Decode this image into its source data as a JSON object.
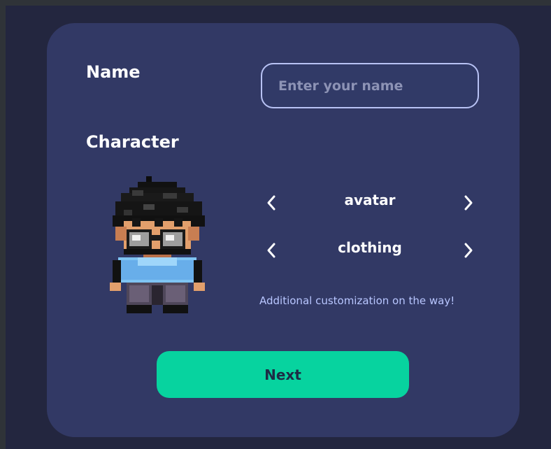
{
  "form": {
    "name_label": "Name",
    "name_placeholder": "Enter your name",
    "name_value": "",
    "character_label": "Character",
    "avatar_option": "avatar",
    "clothing_option": "clothing",
    "note": "Additional customization on the way!",
    "next_label": "Next"
  },
  "icons": {
    "prev": "chevron-left-icon",
    "next": "chevron-right-icon",
    "character": "pixel-character-sprite"
  },
  "colors": {
    "background": "#23263f",
    "card": "#323965",
    "input_border": "#b8c2f4",
    "accent": "#07d39f",
    "note_text": "#b8c6ff",
    "button_text": "#1d2c45"
  }
}
